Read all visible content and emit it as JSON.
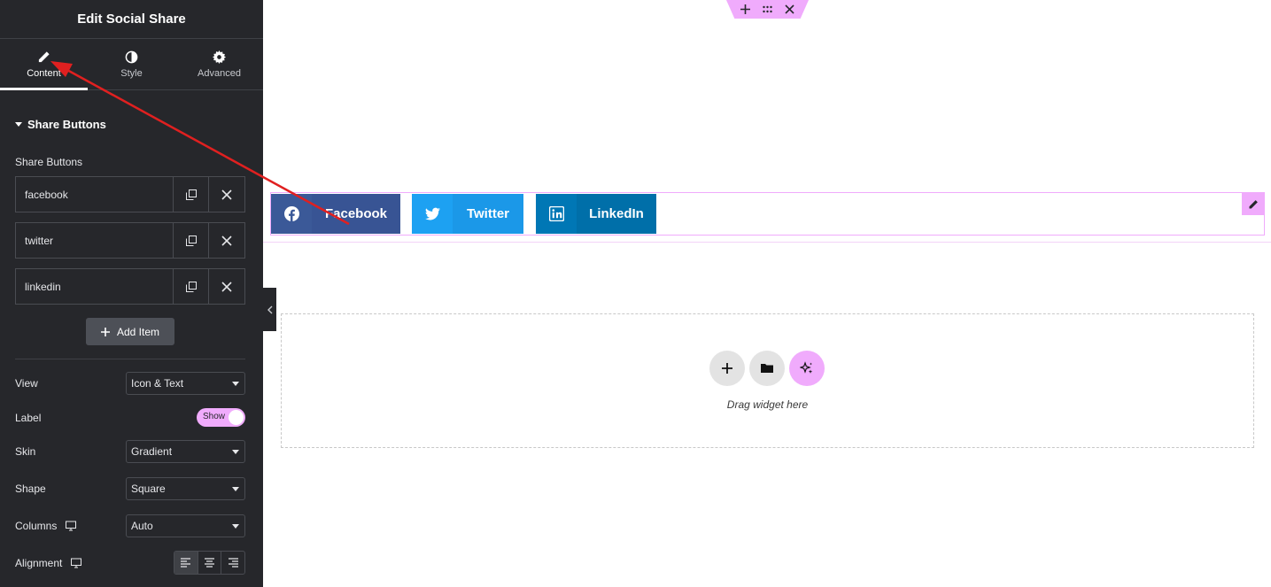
{
  "sidebar": {
    "title": "Edit Social Share",
    "tabs": [
      {
        "label": "Content",
        "icon": "pencil-icon"
      },
      {
        "label": "Style",
        "icon": "half-circle-icon"
      },
      {
        "label": "Advanced",
        "icon": "gear-icon"
      }
    ],
    "active_tab": "Content",
    "section_title": "Share Buttons",
    "repeater_label": "Share Buttons",
    "items": [
      {
        "label": "facebook"
      },
      {
        "label": "twitter"
      },
      {
        "label": "linkedin"
      }
    ],
    "add_item_label": "Add Item",
    "controls": {
      "view": {
        "label": "View",
        "value": "Icon & Text"
      },
      "label": {
        "label": "Label",
        "toggle_text": "Show",
        "on": true
      },
      "skin": {
        "label": "Skin",
        "value": "Gradient"
      },
      "shape": {
        "label": "Shape",
        "value": "Square"
      },
      "columns": {
        "label": "Columns",
        "value": "Auto"
      },
      "alignment": {
        "label": "Alignment",
        "selected": "left"
      }
    }
  },
  "canvas": {
    "share_buttons": [
      {
        "name": "Facebook",
        "icon": "facebook-icon",
        "icon_bg": "#3b5998",
        "text_bg": "#385494"
      },
      {
        "name": "Twitter",
        "icon": "twitter-icon",
        "icon_bg": "#1da1f2",
        "text_bg": "#1b98e8"
      },
      {
        "name": "LinkedIn",
        "icon": "linkedin-icon",
        "icon_bg": "#0077b5",
        "text_bg": "#006fa9"
      }
    ],
    "drop_zone_text": "Drag widget here"
  },
  "colors": {
    "panel_bg": "#26272b",
    "accent_pink": "#f0abfc",
    "annotation_arrow": "#e02020"
  }
}
